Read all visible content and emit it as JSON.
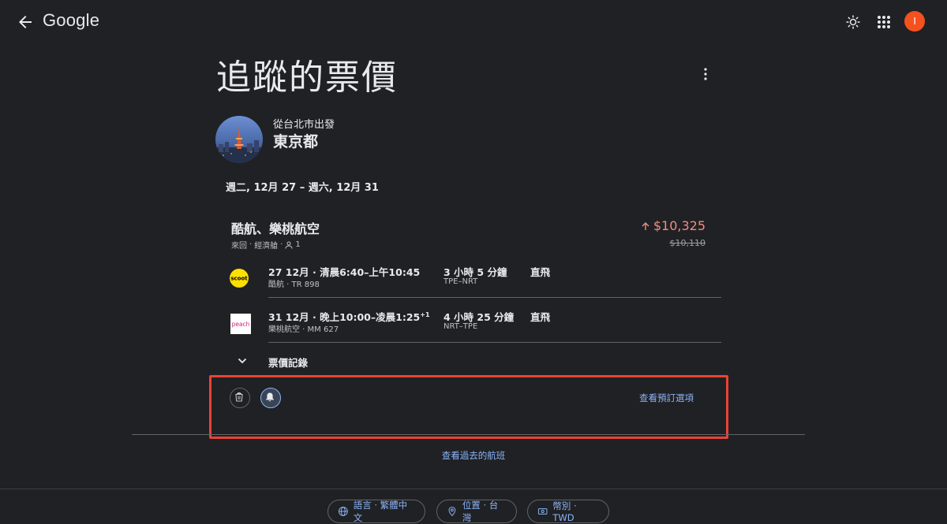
{
  "header": {
    "logo_text": "Google",
    "avatar_initial": "I"
  },
  "page": {
    "title": "追蹤的票價"
  },
  "destination": {
    "origin_label": "從台北市出發",
    "name": "東京都"
  },
  "trip": {
    "date_range": "週二, 12月 27 – 週六, 12月 31",
    "airlines": "酷航、樂桃航空",
    "meta_trip_type": "來回",
    "meta_cabin": "經濟艙",
    "meta_passengers": "1",
    "price_current": "$10,325",
    "price_previous": "$10,110",
    "price_trend": "up"
  },
  "legs": [
    {
      "logo_label": "scoot",
      "time": "27 12月 · 清晨6:40–上午10:45",
      "time_sup": "",
      "airline": "酷航 · TR 898",
      "duration": "3 小時 5 分鐘",
      "route": "TPE–NRT",
      "stops": "直飛"
    },
    {
      "logo_label": "peach",
      "time": "31 12月 · 晚上10:00–凌晨1:25",
      "time_sup": "+1",
      "airline": "樂桃航空 · MM 627",
      "duration": "4 小時 25 分鐘",
      "route": "NRT–TPE",
      "stops": "直飛"
    }
  ],
  "price_history": {
    "label": "票價記錄"
  },
  "actions": {
    "booking_link": "查看預訂選項"
  },
  "past_flights_link": "查看過去的航班",
  "footer": {
    "language": "語言 · 繁體中文",
    "location": "位置 · 台灣",
    "currency": "幣別 · TWD"
  },
  "colors": {
    "background": "#202124",
    "price_up": "#f28b82",
    "link": "#8ab4f8",
    "avatar": "#f4511e",
    "highlight": "#ea4335"
  }
}
